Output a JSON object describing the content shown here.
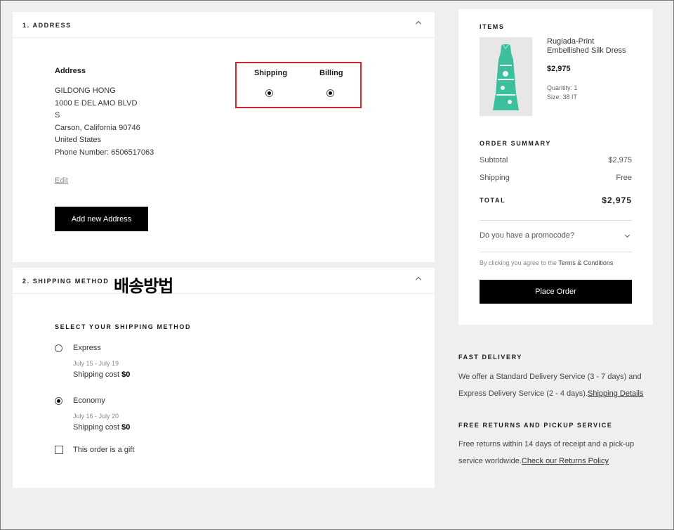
{
  "address": {
    "section_title": "1. ADDRESS",
    "label": "Address",
    "lines": [
      "GILDONG HONG",
      "1000 E DEL AMO BLVD",
      "S",
      "Carson, California 90746",
      "United States",
      "Phone Number: 6506517063"
    ],
    "edit_link": "Edit",
    "add_button": "Add new Address",
    "shipping_label": "Shipping",
    "billing_label": "Billing"
  },
  "shipping": {
    "section_title": "2. SHIPPING METHOD",
    "annotation": "배송방법",
    "subtitle": "SELECT YOUR SHIPPING METHOD",
    "options": [
      {
        "name": "Express",
        "date": "July 15 - July 19",
        "cost_label": "Shipping cost",
        "cost": "$0",
        "selected": false
      },
      {
        "name": "Economy",
        "date": "July 16 - July 20",
        "cost_label": "Shipping cost",
        "cost": "$0",
        "selected": true
      }
    ],
    "gift_label": "This order is a gift"
  },
  "summary": {
    "items_title": "ITEMS",
    "product": {
      "name": "Rugiada-Print Embellished Silk Dress",
      "price": "$2,975",
      "quantity": "Quantity:   1",
      "size": "Size:   38 IT"
    },
    "order_summary_title": "ORDER SUMMARY",
    "subtotal_label": "Subtotal",
    "subtotal_value": "$2,975",
    "shipping_label": "Shipping",
    "shipping_value": "Free",
    "total_label": "TOTAL",
    "total_value": "$2,975",
    "promo_label": "Do you have a promocode?",
    "terms_prefix": "By clicking you agree to the ",
    "terms_link": "Terms & Conditions",
    "place_order": "Place Order"
  },
  "info": {
    "delivery_title": "FAST DELIVERY",
    "delivery_text": "We offer a Standard Delivery Service (3 - 7 days) and Express Delivery Service (2 - 4 days).",
    "delivery_link": "Shipping Details",
    "returns_title": "FREE RETURNS AND PICKUP SERVICE",
    "returns_text": "Free returns within 14 days of receipt and a pick-up service worldwide.",
    "returns_link": "Check our Returns Policy"
  },
  "colors": {
    "accent": "#000000",
    "highlight_box": "#d0262d",
    "background": "#efefef"
  }
}
